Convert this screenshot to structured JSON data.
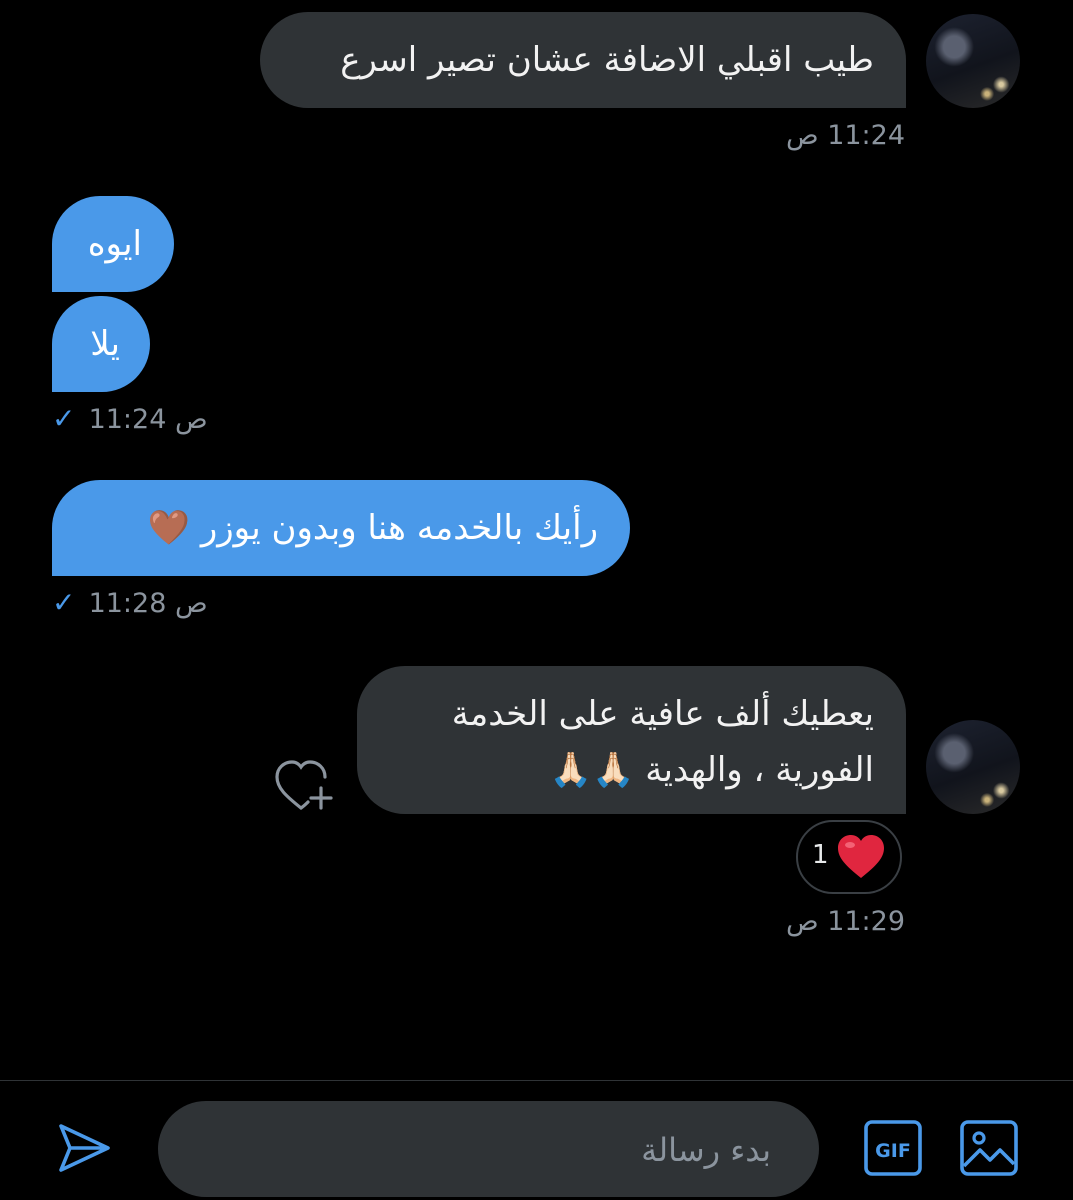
{
  "messages": [
    {
      "id": "m1",
      "text": "طيب اقبلي الاضافة عشان تصير اسرع",
      "time": "11:24 ص"
    },
    {
      "id": "m2",
      "text": "ايوه"
    },
    {
      "id": "m3",
      "text": "يلا",
      "time": "11:24 ص"
    },
    {
      "id": "m4",
      "text": "رأيك بالخدمه هنا وبدون يوزر 🤎",
      "time": "11:28 ص"
    },
    {
      "id": "m5",
      "text": "يعطيك ألف عافية على الخدمة\nالفورية ، والهدية 🙏🏻🙏🏻",
      "time": "11:29 ص",
      "reaction_count": "1"
    }
  ],
  "composer": {
    "placeholder": "بدء رسالة"
  },
  "colors": {
    "incoming": "#2f3336",
    "outgoing": "#4a99e9",
    "background": "#000000"
  },
  "icons": [
    "send-icon",
    "gif-icon",
    "image-icon",
    "add-reaction-icon",
    "heart-icon",
    "check-icon"
  ]
}
